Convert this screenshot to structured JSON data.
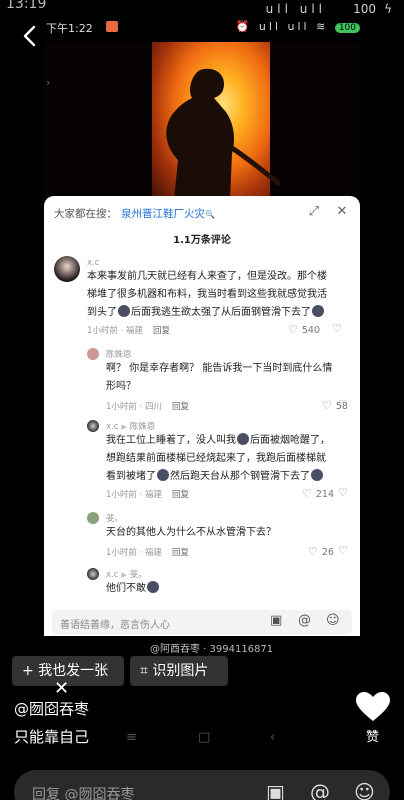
{
  "status_bar": {
    "time": "13:19",
    "signal": "ull ull",
    "battery": "100",
    "charging": "ϟ"
  },
  "inner_screenshot": {
    "status": {
      "time": "下午1:22",
      "right": "⏰ ull ull ≋",
      "battery": "100"
    },
    "search": {
      "prefix": "大家都在搜：",
      "keyword": "泉州晋江鞋厂火灾",
      "icon": "🔍"
    },
    "comment_count": "1.1万条评论",
    "comments": [
      {
        "user": "x.c",
        "text_lines": [
          "本来事发前几天就已经有人来查了，但是没改。那个楼",
          "梯堆了很多机器和布料，我当时看到这些我就感觉我活",
          "到头了",
          "后面我逃生欲太强了从后面钢管滑下去了"
        ],
        "meta": "1小时前 · 福建",
        "reply": "回复",
        "likes": "540"
      },
      {
        "user": "陈姝恩",
        "text_lines": [
          "啊？ 你是幸存者啊？ 能告诉我一下当时到底什么情",
          "形吗？"
        ],
        "meta": "1小时前 · 四川",
        "reply": "回复",
        "likes": "58"
      },
      {
        "user": "x.c",
        "reply_to": "陈姝恩",
        "text_lines": [
          "我在工位上睡着了，没人叫我",
          "后面被烟呛醒了，",
          "想跑结果前面楼梯已经烧起来了，我跑后面楼梯就",
          "看到被堵了",
          "然后跑天台从那个钢管滑下去了"
        ],
        "meta": "1小时前 · 福建",
        "reply": "回复",
        "likes": "214"
      },
      {
        "user": "斐。",
        "text_lines": [
          "天台的其他人为什么不从水管滑下去？"
        ],
        "meta": "1小时前 · 福建",
        "reply": "回复",
        "likes": "26"
      },
      {
        "user": "x.c",
        "reply_to": "斐。",
        "text_lines": [
          "他们不敢"
        ]
      }
    ],
    "input_placeholder": "善语结善缘，恶言伤人心",
    "watermark": "@阿酉吞枣 · 3994116871"
  },
  "buttons": {
    "post_one": "我也发一张",
    "identify": "识别图片"
  },
  "post": {
    "author": "@囫囵吞枣",
    "caption": "只能靠自己",
    "like_label": "赞"
  },
  "comment_bar": {
    "placeholder": "回复 @囫囵吞枣"
  },
  "colors": {
    "accent_blue": "#1f6fd6",
    "background": "#000000",
    "sheet": "#ffffff"
  }
}
